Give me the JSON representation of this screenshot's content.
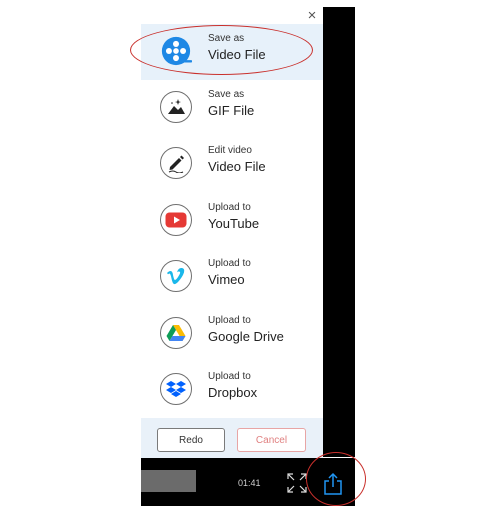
{
  "dialog": {
    "close_glyph": "×",
    "items": [
      {
        "small": "Save as",
        "big": "Video File",
        "icon": "film-reel-icon",
        "selected": true
      },
      {
        "small": "Save as",
        "big": "GIF File",
        "icon": "image-sparkle-icon"
      },
      {
        "small": "Edit video",
        "big": "Video File",
        "icon": "pencil-edit-icon"
      },
      {
        "small": "Upload to",
        "big": "YouTube",
        "icon": "youtube-icon"
      },
      {
        "small": "Upload to",
        "big": "Vimeo",
        "icon": "vimeo-icon"
      },
      {
        "small": "Upload to",
        "big": "Google Drive",
        "icon": "google-drive-icon"
      },
      {
        "small": "Upload to",
        "big": "Dropbox",
        "icon": "dropbox-icon"
      }
    ],
    "redo_label": "Redo",
    "cancel_label": "Cancel"
  },
  "player": {
    "time": "01:41"
  },
  "colors": {
    "selected_bg": "#e7f1fa",
    "annotation_red": "#c9302c",
    "accent_blue": "#1e88e5",
    "youtube_red": "#e53935",
    "vimeo_blue": "#1ab7ea",
    "dropbox_blue": "#0061fe"
  }
}
